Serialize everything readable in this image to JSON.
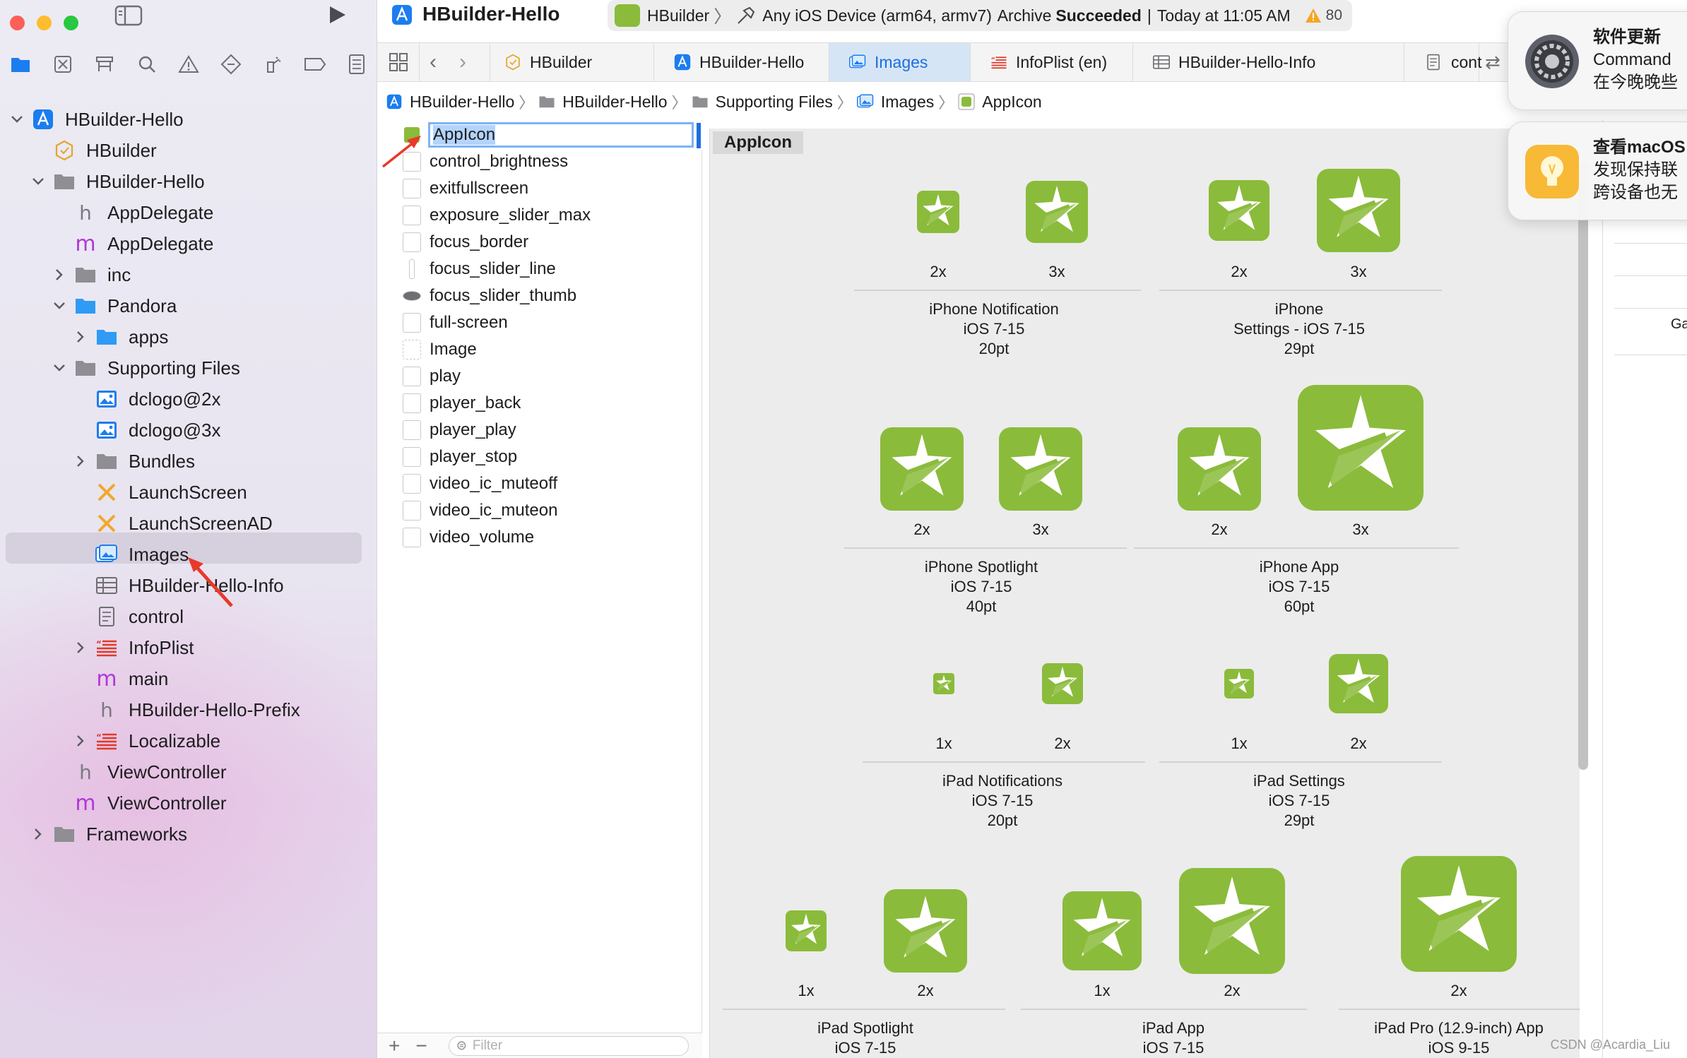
{
  "navigator": {
    "tree": [
      {
        "label": "HBuilder-Hello",
        "icon": "project-icon",
        "chev": "down",
        "indent": 0
      },
      {
        "label": "HBuilder",
        "icon": "target-icon",
        "chev": "",
        "indent": 1
      },
      {
        "label": "HBuilder-Hello",
        "icon": "folder-icon",
        "chev": "down",
        "indent": 1
      },
      {
        "label": "AppDelegate",
        "icon": "h-file-icon",
        "chev": "",
        "indent": 2
      },
      {
        "label": "AppDelegate",
        "icon": "m-file-icon",
        "chev": "",
        "indent": 2
      },
      {
        "label": "inc",
        "icon": "folder-icon",
        "chev": "right",
        "indent": 2
      },
      {
        "label": "Pandora",
        "icon": "blue-folder-icon",
        "chev": "down",
        "indent": 2
      },
      {
        "label": "apps",
        "icon": "blue-folder-icon",
        "chev": "right",
        "indent": 3
      },
      {
        "label": "Supporting Files",
        "icon": "folder-icon",
        "chev": "down",
        "indent": 2
      },
      {
        "label": "dclogo@2x",
        "icon": "image-icon",
        "chev": "",
        "indent": 3
      },
      {
        "label": "dclogo@3x",
        "icon": "image-icon",
        "chev": "",
        "indent": 3
      },
      {
        "label": "Bundles",
        "icon": "folder-icon",
        "chev": "right",
        "indent": 3
      },
      {
        "label": "LaunchScreen",
        "icon": "storyboard-icon",
        "chev": "",
        "indent": 3
      },
      {
        "label": "LaunchScreenAD",
        "icon": "storyboard-icon",
        "chev": "",
        "indent": 3
      },
      {
        "label": "Images",
        "icon": "asset-catalog-icon",
        "chev": "",
        "indent": 3
      },
      {
        "label": "HBuilder-Hello-Info",
        "icon": "plist-icon",
        "chev": "",
        "indent": 3
      },
      {
        "label": "control",
        "icon": "document-icon",
        "chev": "",
        "indent": 3
      },
      {
        "label": "InfoPlist",
        "icon": "strings-icon",
        "chev": "right",
        "indent": 3
      },
      {
        "label": "main",
        "icon": "m-file-icon",
        "chev": "",
        "indent": 3
      },
      {
        "label": "HBuilder-Hello-Prefix",
        "icon": "h-file-icon",
        "chev": "",
        "indent": 3
      },
      {
        "label": "Localizable",
        "icon": "strings-icon",
        "chev": "right",
        "indent": 3
      },
      {
        "label": "ViewController",
        "icon": "h-file-icon",
        "chev": "",
        "indent": 2
      },
      {
        "label": "ViewController",
        "icon": "m-file-icon",
        "chev": "",
        "indent": 2
      },
      {
        "label": "Frameworks",
        "icon": "folder-icon",
        "chev": "right",
        "indent": 1
      }
    ]
  },
  "titlebar": {
    "project": "HBuilder-Hello",
    "scheme": "HBuilder",
    "destination": "Any iOS Device (arm64, armv7)",
    "status_prefix": "Archive",
    "status_bold": "Succeeded",
    "status_sep": "|",
    "status_time": "Today at 11:05 AM",
    "warnings": "80"
  },
  "tabs": [
    {
      "label": "HBuilder",
      "icon": "target-icon"
    },
    {
      "label": "HBuilder-Hello",
      "icon": "project-icon"
    },
    {
      "label": "Images",
      "icon": "asset-catalog-icon"
    },
    {
      "label": "InfoPlist (en)",
      "icon": "strings-icon"
    },
    {
      "label": "HBuilder-Hello-Info",
      "icon": "plist-icon"
    },
    {
      "label": "cont",
      "icon": "document-icon"
    }
  ],
  "breadcrumbs": [
    "HBuilder-Hello",
    "HBuilder-Hello",
    "Supporting Files",
    "Images",
    "AppIcon"
  ],
  "asset_list": {
    "items": [
      "AppIcon",
      "control_brightness",
      "exitfullscreen",
      "exposure_slider_max",
      "focus_border",
      "focus_slider_line",
      "focus_slider_thumb",
      "full-screen",
      "Image",
      "play",
      "player_back",
      "player_play",
      "player_stop",
      "video_ic_muteoff",
      "video_ic_muteon",
      "video_volume"
    ],
    "filter_placeholder": "Filter",
    "add_label": "+",
    "remove_label": "−"
  },
  "appicon": {
    "title": "AppIcon",
    "groups": [
      {
        "name": "iPhone Notification",
        "os": "iOS 7-15",
        "size": "20pt",
        "slots": [
          "2x",
          "3x"
        ]
      },
      {
        "name": "iPhone",
        "name2": "Settings - iOS 7-15",
        "size": "29pt",
        "slots": [
          "2x",
          "3x"
        ]
      },
      {
        "name": "iPhone Spotlight",
        "os": "iOS 7-15",
        "size": "40pt",
        "slots": [
          "2x",
          "3x"
        ]
      },
      {
        "name": "iPhone App",
        "os": "iOS 7-15",
        "size": "60pt",
        "slots": [
          "2x",
          "3x"
        ]
      },
      {
        "name": "iPad Notifications",
        "os": "iOS 7-15",
        "size": "20pt",
        "slots": [
          "1x",
          "2x"
        ]
      },
      {
        "name": "iPad Settings",
        "os": "iOS 7-15",
        "size": "29pt",
        "slots": [
          "1x",
          "2x"
        ]
      },
      {
        "name": "iPad Spotlight",
        "os": "iOS 7-15",
        "slots": [
          "1x",
          "2x"
        ]
      },
      {
        "name": "iPad App",
        "os": "iOS 7-15",
        "slots": [
          "1x",
          "2x"
        ]
      },
      {
        "name": "iPad Pro (12.9-inch) App",
        "os": "iOS 9-15",
        "slots": [
          "2x"
        ]
      }
    ]
  },
  "inspector": {
    "partial_text": "Ga"
  },
  "notifications": [
    {
      "title": "软件更新",
      "line1": "Command",
      "line2": "在今晚晚些",
      "icon": "gear-icon"
    },
    {
      "title": "查看macOS",
      "line1": "发现保持联",
      "line2": "跨设备也无",
      "icon": "lightbulb-icon"
    }
  ],
  "watermark": "CSDN @Acardia_Liu",
  "colors": {
    "accent": "#1b6fe0",
    "icon_green": "#8bbb3b",
    "annotation_red": "#e8392a"
  }
}
